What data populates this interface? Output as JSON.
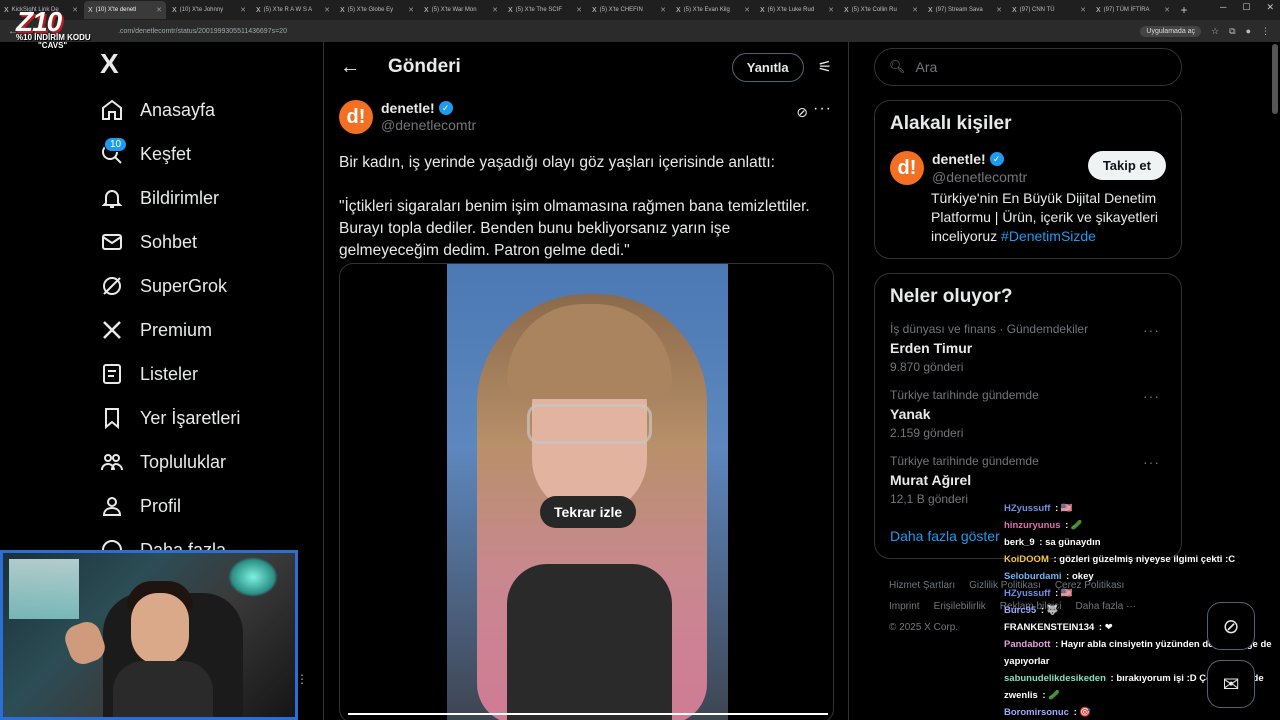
{
  "browser": {
    "tabs": [
      {
        "title": "KickSight Link De",
        "active": false
      },
      {
        "title": "(10) X'te denetl",
        "active": true
      },
      {
        "title": "(10) X'te Johnny",
        "active": false
      },
      {
        "title": "(5) X'te R A W S A",
        "active": false
      },
      {
        "title": "(5) X'te Globe Ey",
        "active": false
      },
      {
        "title": "(5) X'te War Mon",
        "active": false
      },
      {
        "title": "(5) X'te The SCIF",
        "active": false
      },
      {
        "title": "(5) X'te CHEFIN",
        "active": false
      },
      {
        "title": "(5) X'te Evan Kilg",
        "active": false
      },
      {
        "title": "(6) X'te Luke Rud",
        "active": false
      },
      {
        "title": "(5) X'te Collin Ru",
        "active": false
      },
      {
        "title": "(97) Stream Sava",
        "active": false
      },
      {
        "title": "(97) CNN TÜ",
        "active": false
      },
      {
        "title": "(97) TÜM İFTİRA",
        "active": false
      }
    ],
    "url": ".com/denetlecomtr/status/2001999305511436697s=20",
    "install_label": "Uygulamada aç"
  },
  "stream": {
    "logo": "Z10",
    "promo_line1": "%10 İNDİRİM KODU",
    "promo_line2": "\"CAVS\""
  },
  "nav": {
    "logo": "X",
    "notification_count": "10",
    "items": [
      {
        "label": "Anasayfa",
        "icon": "home-icon"
      },
      {
        "label": "Keşfet",
        "icon": "search-icon"
      },
      {
        "label": "Bildirimler",
        "icon": "bell-icon"
      },
      {
        "label": "Sohbet",
        "icon": "mail-icon"
      },
      {
        "label": "SuperGrok",
        "icon": "grok-icon"
      },
      {
        "label": "Premium",
        "icon": "x-icon"
      },
      {
        "label": "Listeler",
        "icon": "list-icon"
      },
      {
        "label": "Yer İşaretleri",
        "icon": "bookmark-icon"
      },
      {
        "label": "Topluluklar",
        "icon": "people-icon"
      },
      {
        "label": "Profil",
        "icon": "person-icon"
      },
      {
        "label": "Daha fazla",
        "icon": "more-circle-icon"
      }
    ]
  },
  "post": {
    "header_title": "Gönderi",
    "reply_label": "Yanıtla",
    "author_name": "denetle!",
    "author_handle": "@denetlecomtr",
    "avatar_text": "d!",
    "text": "Bir kadın, iş yerinde yaşadığı olayı göz yaşları içerisinde anlattı:\n\n\"İçtikleri sigaraları benim işim olmamasına rağmen bana temizlettiler. Burayı topla dediler. Benden bunu bekliyorsanız yarın işe gelmeyeceğim dedim. Patron gelme dedi.\"",
    "replay_label": "Tekrar izle",
    "video_progress": 1.0
  },
  "right": {
    "search_placeholder": "Ara",
    "related": {
      "title": "Alakalı kişiler",
      "name": "denetle!",
      "handle": "@denetlecomtr",
      "follow_label": "Takip et",
      "bio": "Türkiye'nin En Büyük Dijital Denetim Platformu | Ürün, içerik ve şikayetleri inceliyoruz",
      "bio_tag": "#DenetimSizde"
    },
    "trends": {
      "title": "Neler oluyor?",
      "items": [
        {
          "context": "İş dünyası ve finans · Gündemdekiler",
          "name": "Erden Timur",
          "count": "9.870 gönderi"
        },
        {
          "context": "Türkiye tarihinde gündemde",
          "name": "Yanak",
          "count": "2.159 gönderi"
        },
        {
          "context": "Türkiye tarihinde gündemde",
          "name": "Murat Ağırel",
          "count": "12,1 B gönderi"
        }
      ],
      "show_more": "Daha fazla göster"
    },
    "footer": [
      "Hizmet Şartları",
      "Gizlilik Politikası",
      "Çerez Politikası",
      "Imprint",
      "Erişilebilirlik",
      "Reklam bilgisi",
      "Daha fazla ···",
      "© 2025 X Corp."
    ]
  },
  "chat": [
    {
      "user": "HZyussuff",
      "color": "#6f8fe0",
      "msg": " : 🇺🇸"
    },
    {
      "user": "hinzuryunus",
      "color": "#e06fb0",
      "msg": " : 🥒"
    },
    {
      "user": "berk_9",
      "color": "#ffffff",
      "msg": " : sa günaydın"
    },
    {
      "user": "KoiDOOM",
      "color": "#f5c542",
      "msg": " : gözleri güzelmiş niyeyse ilgimi çekti :C"
    },
    {
      "user": "Seloburdami",
      "color": "#6fb3f0",
      "msg": " : okey"
    },
    {
      "user": "HZyussuff",
      "color": "#6f8fe0",
      "msg": " : 🇺🇸"
    },
    {
      "user": "Burc95",
      "color": "#9fa8ff",
      "msg": " : 🐺"
    },
    {
      "user": "FRANKENSTEIN134",
      "color": "#ffffff",
      "msg": " : ❤"
    },
    {
      "user": "Pandabott",
      "color": "#e89be0",
      "msg": " : Hayır abla cinsiyetin yüzünden değil erkeğe de yapıyorlar"
    },
    {
      "user": "sabunudelikdesikeden",
      "color": "#7fe0c0",
      "msg": " : bırakıyorum işi :D Çokta sikimde"
    },
    {
      "user": "zwenlis",
      "color": "#ffffff",
      "msg": " : 🥒"
    },
    {
      "user": "Boromirsonuc",
      "color": "#9fa8ff",
      "msg": " : 🎯"
    }
  ]
}
